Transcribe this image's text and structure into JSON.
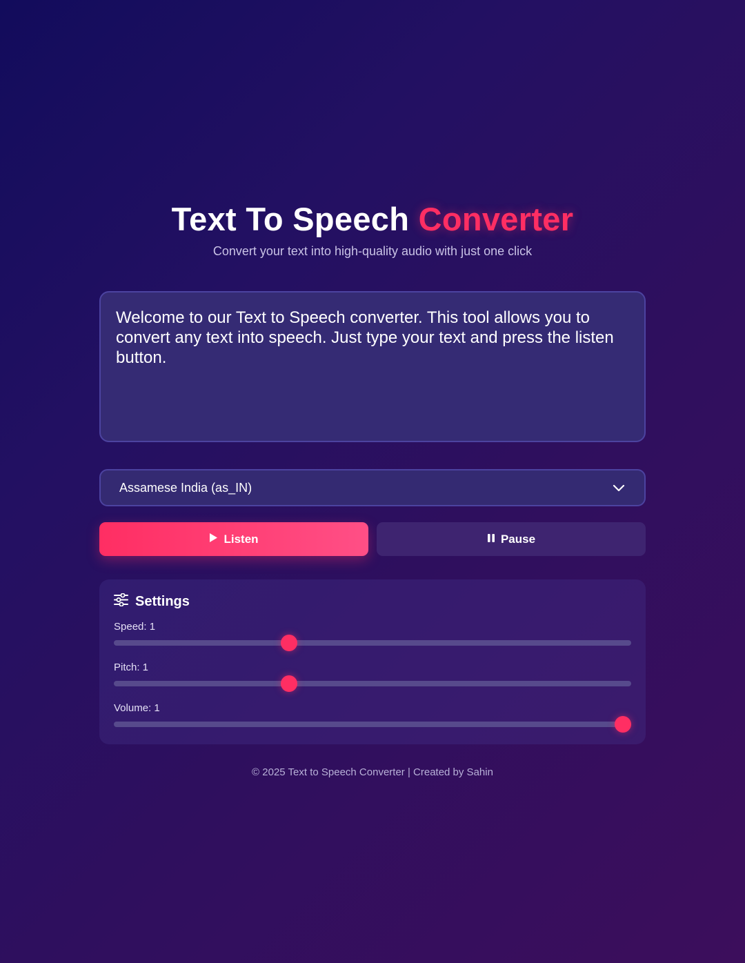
{
  "header": {
    "title_main": "Text To Speech ",
    "title_accent": "Converter",
    "subtitle": "Convert your text into high-quality audio with just one click"
  },
  "input": {
    "text": "Welcome to our Text to Speech converter. This tool allows you to convert any text into speech. Just type your text and press the listen button."
  },
  "voice_select": {
    "selected": "Assamese India (as_IN)",
    "icon": "chevron-down-icon"
  },
  "buttons": {
    "listen_label": "Listen",
    "listen_icon": "play-icon",
    "pause_label": "Pause",
    "pause_icon": "pause-icon"
  },
  "settings": {
    "title": "Settings",
    "icon": "sliders-icon",
    "speed": {
      "label": "Speed: 1",
      "value": 1,
      "min": 0.5,
      "max": 2
    },
    "pitch": {
      "label": "Pitch: 1",
      "value": 1,
      "min": 0.5,
      "max": 2
    },
    "volume": {
      "label": "Volume: 1",
      "value": 1,
      "min": 0,
      "max": 1
    }
  },
  "footer": {
    "text": "© 2025 Text to Speech Converter | Created by Sahin"
  },
  "colors": {
    "accent": "#ff2e63",
    "panel": "#352b74",
    "background_start": "#120c5c",
    "background_end": "#3c0e5c"
  }
}
